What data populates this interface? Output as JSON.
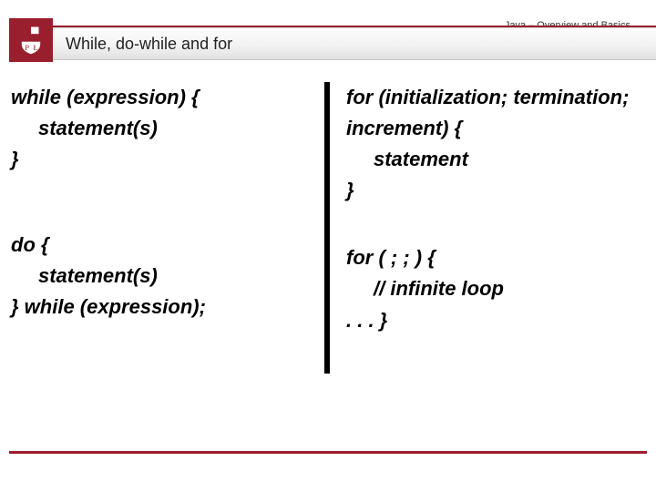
{
  "breadcrumb": "Java – Overview and Basics",
  "title": "While, do-while and for",
  "left": {
    "whileBlock": {
      "l1": "while (expression) {",
      "l2": "statement(s)",
      "l3": "}"
    },
    "doBlock": {
      "l1": "do {",
      "l2": "statement(s)",
      "l3": "} while (expression);"
    }
  },
  "right": {
    "forBlock": {
      "l1": "for (initialization; termination; increment) {",
      "l2": "statement",
      "l3": "}"
    },
    "infBlock": {
      "l1": "for ( ; ; ) {",
      "l2": "// infinite loop",
      "l3": ". . . }"
    }
  }
}
